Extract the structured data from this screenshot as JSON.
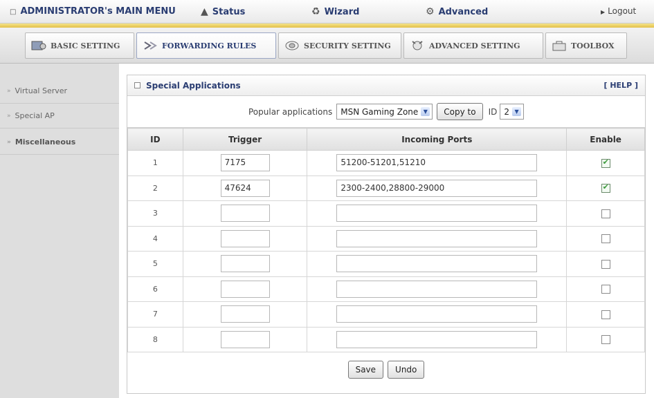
{
  "topbar": {
    "main_menu": "ADMINISTRATOR's MAIN MENU",
    "status": "Status",
    "wizard": "Wizard",
    "advanced": "Advanced",
    "logout": "Logout"
  },
  "tabs": {
    "basic": "BASIC SETTING",
    "forwarding": "FORWARDING RULES",
    "security": "SECURITY SETTING",
    "advanced": "ADVANCED SETTING",
    "toolbox": "TOOLBOX"
  },
  "sidebar": {
    "items": [
      {
        "label": "Virtual Server"
      },
      {
        "label": "Special AP"
      },
      {
        "label": "Miscellaneous"
      }
    ]
  },
  "panel": {
    "title": "Special Applications",
    "help": "[ HELP ]"
  },
  "popular": {
    "label": "Popular applications",
    "selected_app": "MSN Gaming Zone",
    "copy_button": "Copy to",
    "id_label": "ID",
    "selected_id": "2"
  },
  "table": {
    "headers": {
      "id": "ID",
      "trigger": "Trigger",
      "ports": "Incoming Ports",
      "enable": "Enable"
    },
    "rows": [
      {
        "id": "1",
        "trigger": "7175",
        "ports": "51200-51201,51210",
        "enabled": true
      },
      {
        "id": "2",
        "trigger": "47624",
        "ports": "2300-2400,28800-29000",
        "enabled": true
      },
      {
        "id": "3",
        "trigger": "",
        "ports": "",
        "enabled": false
      },
      {
        "id": "4",
        "trigger": "",
        "ports": "",
        "enabled": false
      },
      {
        "id": "5",
        "trigger": "",
        "ports": "",
        "enabled": false
      },
      {
        "id": "6",
        "trigger": "",
        "ports": "",
        "enabled": false
      },
      {
        "id": "7",
        "trigger": "",
        "ports": "",
        "enabled": false
      },
      {
        "id": "8",
        "trigger": "",
        "ports": "",
        "enabled": false
      }
    ]
  },
  "buttons": {
    "save": "Save",
    "undo": "Undo"
  },
  "colors": {
    "accent_text": "#2a3d72",
    "gold_bar": "#e2c04a",
    "sidebar_bg": "#dedede",
    "check_green": "#3c9a3c"
  }
}
